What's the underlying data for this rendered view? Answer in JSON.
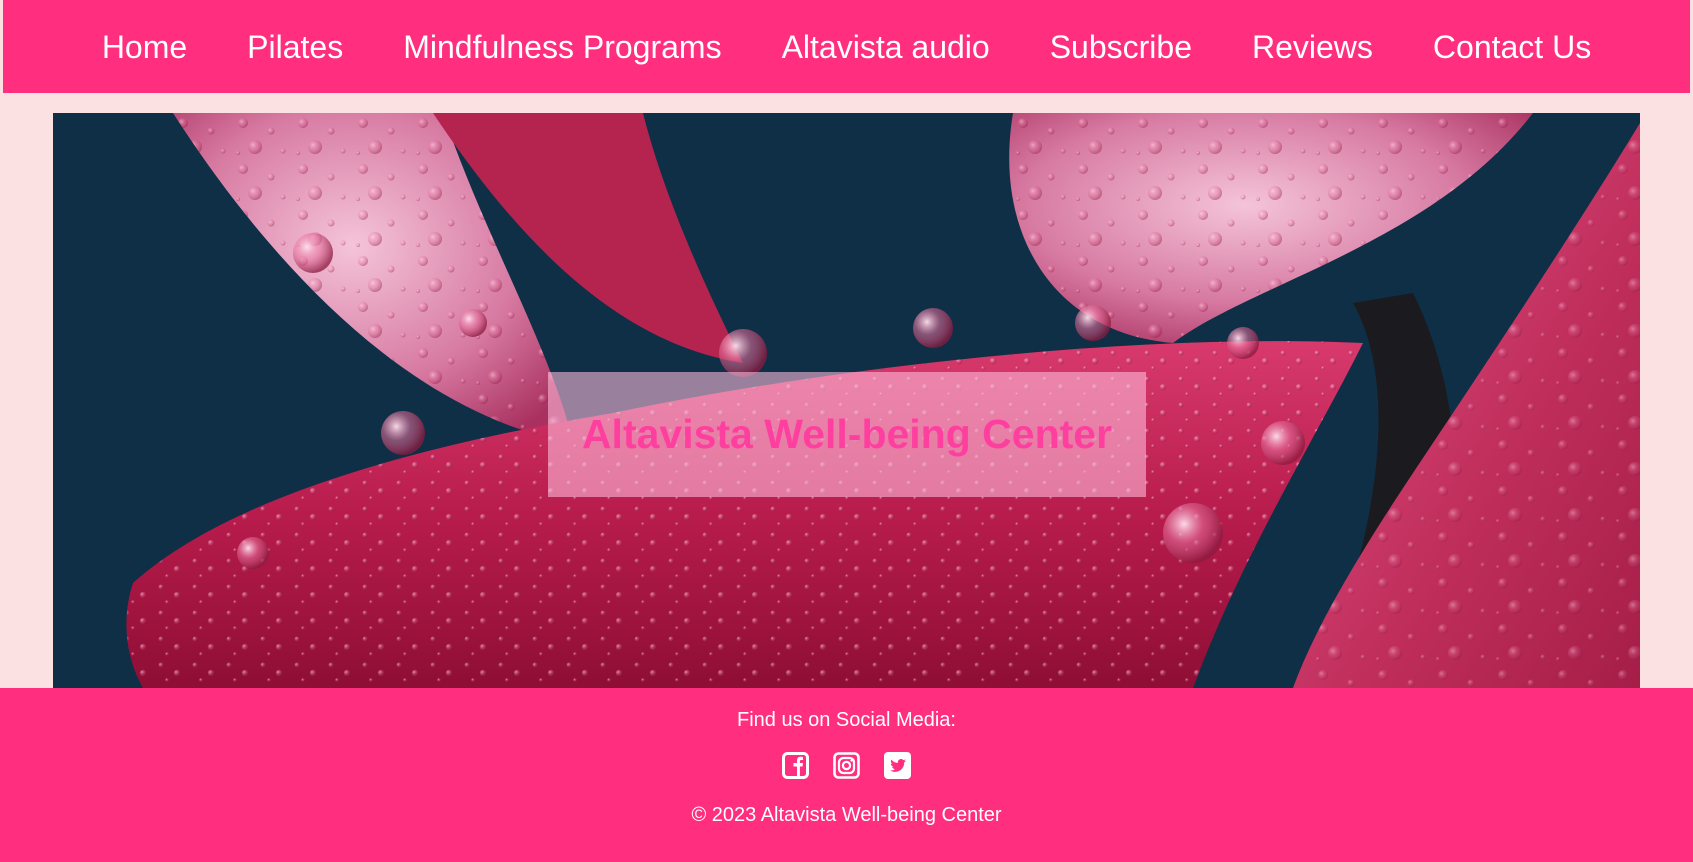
{
  "nav": {
    "items": [
      {
        "label": "Home"
      },
      {
        "label": "Pilates"
      },
      {
        "label": "Mindfulness Programs"
      },
      {
        "label": "Altavista audio"
      },
      {
        "label": "Subscribe"
      },
      {
        "label": "Reviews"
      },
      {
        "label": "Contact Us"
      }
    ]
  },
  "hero": {
    "title": "Altavista Well-being Center",
    "image": "pink-flower-petals-with-water-droplets"
  },
  "footer": {
    "social_heading": "Find us on Social Media:",
    "social_icons": [
      "facebook-icon",
      "instagram-icon",
      "twitter-icon"
    ],
    "copyright": "© 2023 Altavista Well-being Center"
  },
  "colors": {
    "brand_pink": "#ff2e7e",
    "page_background": "#fbe1e1",
    "hero_title": "#ff3fa0",
    "hero_title_box": "rgba(255,190,220,0.58)"
  }
}
